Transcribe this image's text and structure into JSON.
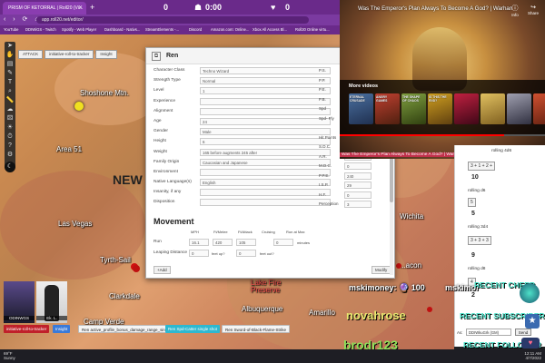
{
  "browser": {
    "tab_title": "PRISM OF KETORRAL | Roll20 (Vi...",
    "url": "app.roll20.net/editor/",
    "nav_icons": "‹ › ⟳ ⌂",
    "bookmarks": [
      "YouTube",
      "DDIWiGS - Twitch",
      "Spotify - Web Player",
      "Dashboard - Nativs...",
      "StreamElements -...",
      "Discord",
      "Amazon.com: Online...",
      "Xbox All Access Bl...",
      "Roll20 Online virtu..."
    ]
  },
  "stream_top": {
    "left_value": "0",
    "mid_value": "0:00",
    "right_value": "0"
  },
  "map": {
    "labels": [
      "Shoshone Mtn.",
      "Area 51",
      "NEW",
      "Las Vegas",
      "Tyrth-Sail",
      "Clarkdale",
      "Camp Verde",
      "Wichita",
      "Amarillo",
      "Albuquerque",
      "Lake Fire Preserve",
      "...acon"
    ],
    "token_selector": [
      "ATTACK",
      "initiative-roll-to-tracker",
      "Insight"
    ]
  },
  "dialog": {
    "title": "Ren",
    "close": "×",
    "left_fields": [
      {
        "label": "Character Class",
        "value": "Techno Wizard"
      },
      {
        "label": "Strength Type",
        "value": "Normal"
      },
      {
        "label": "Level",
        "value": "1"
      },
      {
        "label": "Experience",
        "value": ""
      },
      {
        "label": "Alignment",
        "value": ""
      },
      {
        "label": "Age",
        "value": "24"
      },
      {
        "label": "Gender",
        "value": "Male"
      },
      {
        "label": "Height",
        "value": "6"
      },
      {
        "label": "Weight",
        "value": "165 before augments  245 after"
      },
      {
        "label": "Family Origin",
        "value": "Caucasian and Japanese"
      },
      {
        "label": "Environment",
        "value": ""
      },
      {
        "label": "Native Language(s)",
        "value": "English"
      },
      {
        "label": "Insanity, if any",
        "value": ""
      },
      {
        "label": "Disposition",
        "value": ""
      }
    ],
    "right_fields": [
      {
        "label": "P.S.",
        "value": ""
      },
      {
        "label": "P.P.",
        "value": ""
      },
      {
        "label": "P.E.",
        "value": ""
      },
      {
        "label": "P.B.",
        "value": ""
      },
      {
        "label": "Spd",
        "value": ""
      },
      {
        "label": "Spd- Fly",
        "value": ""
      },
      {
        "label": "",
        "value": ""
      },
      {
        "label": "Hit Points",
        "value": "17"
      },
      {
        "label": "S.D.C.",
        "value": "18"
      },
      {
        "label": "A.R.",
        "value": "9"
      },
      {
        "label": "M.D.C.",
        "value": "0"
      },
      {
        "label": "P.P.E.",
        "value": "240"
      },
      {
        "label": "I.S.P.",
        "value": "29"
      },
      {
        "label": "H.F.",
        "value": "0"
      },
      {
        "label": "Perception",
        "value": "3"
      }
    ],
    "movement": {
      "title": "Movement",
      "headers": [
        "MPH",
        "Ft/Melee",
        "Ft/Attack",
        "Cruising",
        "Run at Max"
      ],
      "run_label": "Run",
      "run_values": [
        "16.1",
        "420",
        "105",
        "0"
      ],
      "run_unit": "minutes",
      "leap_label": "Leaping Distance",
      "leap_values": [
        "0",
        "0"
      ],
      "leap_hints": [
        "feet up?",
        "feet out?"
      ]
    },
    "add_label": "+Add",
    "modify_label": "Modify"
  },
  "youtube": {
    "title": "Was The Emperor's Plan Always To Become A God? | Warhamm...",
    "info_label": "Info",
    "share_label": "Share",
    "more_videos_label": "More videos",
    "thumbs": [
      "ETERNAL CRUSADE",
      "ANGRY GAMES",
      "THE SHAPE OF CHAOS",
      "IS THIS THE END?",
      "",
      "",
      "",
      ""
    ],
    "rewatch": "Was The Emperor's Plan Always To Become A God? | Warhammer 40k Lore",
    "progress": 0.8
  },
  "chat": {
    "lines": [
      "rolling 4d6",
      "rolling d6",
      "rolling 3d4",
      "rolling d8",
      "rolling 1d6"
    ],
    "nums": [
      "10",
      "5",
      "9",
      "2"
    ],
    "dice_top": "3 + 1 + 2 +",
    "dice_5": "5",
    "dice_3d4": "3 + 3 + 3",
    "dice_d8": "4",
    "as_label": "As:",
    "as_value": "DDIWkuGrk (GM)",
    "send_label": "Send"
  },
  "overlay": {
    "money": "mskimoney: 🔮 100",
    "mskimor": "mskimor",
    "novah": "novahrose",
    "brodr": "brodr123",
    "recent_cheer": "RECENT CHEER",
    "recent_sub": "RECENT SUBSCRIBER",
    "recent_follower": "RECENT FOLLOWER"
  },
  "portraits": [
    "ODINWGS",
    "Ek. L."
  ],
  "macros": [
    {
      "label": "initiative-roll-to-tracker",
      "color": "#c0202a"
    },
    {
      "label": "Insight",
      "color": "#3a7ad8"
    },
    {
      "label": "Ren active_profile_bonus_damage_range_single",
      "color": "#f4f4f4"
    },
    {
      "label": "Ren Spd-Catter single shot",
      "color": "#2eb8d0"
    },
    {
      "label": "Ren Sword-of-Black-Flame-Strike",
      "color": "#f4f4f4"
    }
  ],
  "taskbar": {
    "weather_temp": "69°F",
    "weather_desc": "Sunny",
    "time": "12:11 AM",
    "date": "4/7/2022"
  },
  "colors": {
    "browser_purple": "#6a2a8a",
    "recent_teal": "#4de0c8",
    "chat_green": "#8ee05a"
  }
}
